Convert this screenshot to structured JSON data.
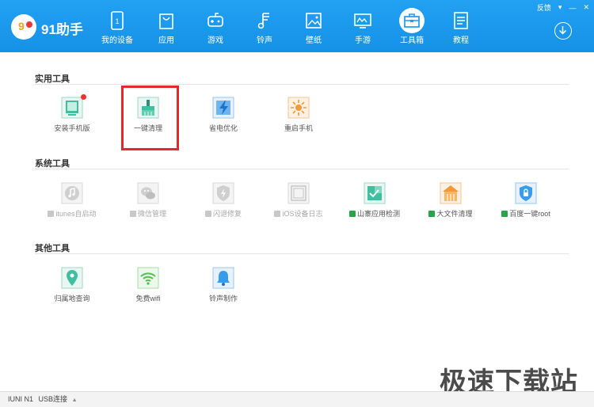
{
  "app": {
    "name": "91助手",
    "logo_text": "9"
  },
  "top_links": {
    "feedback": "反馈",
    "menu": "▾",
    "minimize": "—",
    "close": "✕"
  },
  "nav": [
    {
      "label": "我的设备",
      "icon": "phone-icon"
    },
    {
      "label": "应用",
      "icon": "bag-icon"
    },
    {
      "label": "游戏",
      "icon": "gamepad-icon"
    },
    {
      "label": "铃声",
      "icon": "music-note-icon"
    },
    {
      "label": "壁纸",
      "icon": "picture-icon"
    },
    {
      "label": "手游",
      "icon": "monitor-game-icon"
    },
    {
      "label": "工具箱",
      "icon": "toolbox-icon",
      "active": true
    },
    {
      "label": "教程",
      "icon": "document-icon"
    }
  ],
  "sections": {
    "practical": {
      "title": "实用工具",
      "tools": [
        {
          "label": "安装手机版",
          "icon": "tablet-install-icon",
          "color": "#3fbf9f",
          "badge": true
        },
        {
          "label": "一键清理",
          "icon": "broom-icon",
          "color": "#3fbf9f"
        },
        {
          "label": "省电优化",
          "icon": "lightning-icon",
          "color": "#3a9be8"
        },
        {
          "label": "重启手机",
          "icon": "restart-icon",
          "color": "#f29a35"
        }
      ]
    },
    "system": {
      "title": "系统工具",
      "tools": [
        {
          "label": "itunes自启动",
          "icon": "music-disc-icon",
          "disabled": true
        },
        {
          "label": "微信管理",
          "icon": "wechat-icon",
          "disabled": true
        },
        {
          "label": "闪退修复",
          "icon": "shield-bolt-icon",
          "disabled": true
        },
        {
          "label": "iOS设备日志",
          "icon": "ios-log-icon",
          "disabled": true
        },
        {
          "label": "山寨应用检测",
          "icon": "check-box-icon",
          "color": "#3fbf9f"
        },
        {
          "label": "大文件清理",
          "icon": "house-file-icon",
          "color": "#f29a35"
        },
        {
          "label": "百度一键root",
          "icon": "lock-shield-icon",
          "color": "#3a9be8"
        }
      ]
    },
    "other": {
      "title": "其他工具",
      "tools": [
        {
          "label": "归属地查询",
          "icon": "location-pin-icon",
          "color": "#3fbf9f"
        },
        {
          "label": "免费wifi",
          "icon": "wifi-icon",
          "color": "#4cc24c"
        },
        {
          "label": "铃声制作",
          "icon": "bell-icon",
          "color": "#3a9be8"
        }
      ]
    }
  },
  "status": {
    "device": "IUNI N1",
    "connection": "USB连接",
    "arrow": "▲"
  },
  "watermark": "极速下载站"
}
